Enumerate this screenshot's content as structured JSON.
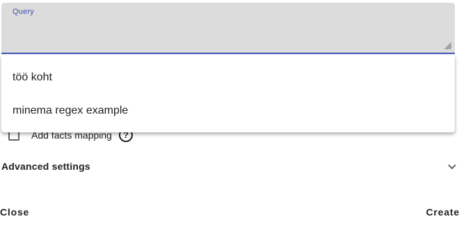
{
  "query": {
    "label": "Query",
    "value": ""
  },
  "autocomplete": {
    "options": [
      {
        "label": "töö koht"
      },
      {
        "label": "minema regex example"
      }
    ]
  },
  "facts_mapping": {
    "label": "Add facts mapping",
    "checked": false,
    "help_icon": "help-circle-icon"
  },
  "advanced": {
    "label": "Advanced settings",
    "icon": "chevron-down-icon"
  },
  "actions": {
    "close_label": "Close",
    "create_label": "Create"
  },
  "colors": {
    "accent": "#3f51b5",
    "field_background": "#dcdcdc"
  }
}
